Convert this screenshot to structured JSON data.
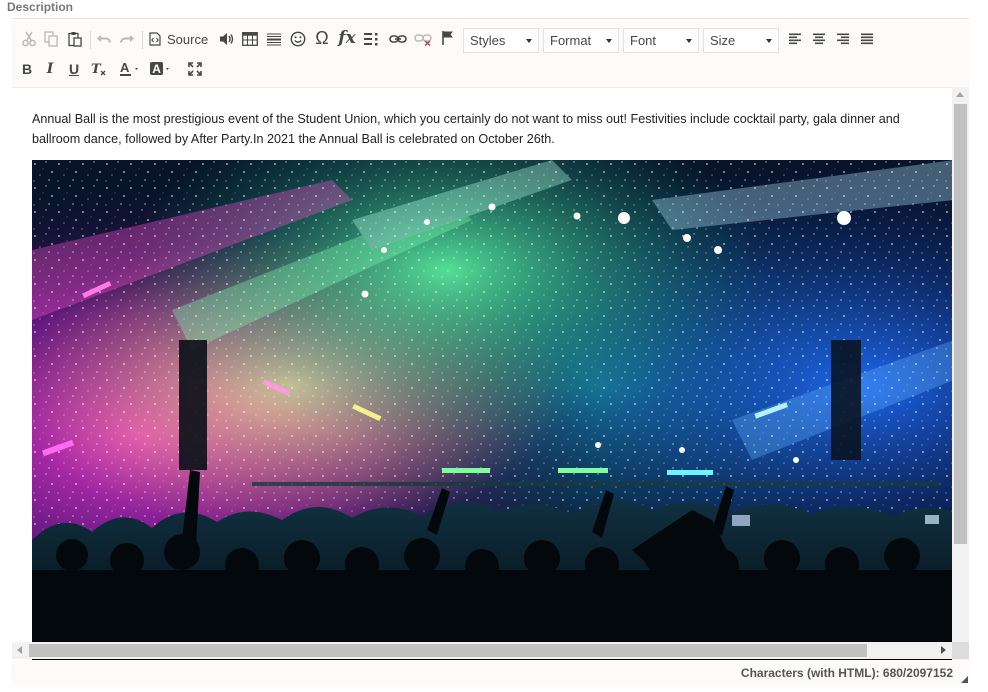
{
  "field": {
    "label": "Description"
  },
  "toolbar": {
    "source_label": "Source",
    "styles_label": "Styles",
    "format_label": "Format",
    "font_label": "Font",
    "size_label": "Size",
    "fx_label": "fx"
  },
  "content": {
    "paragraph": " Annual Ball is the most prestigious event of the Student Union, which you certainly do not want to miss out! Festivities include cocktail party, gala dinner and ballroom dance, followed by After Party.In 2021 the Annual Ball is celebrated on October 26th."
  },
  "status": {
    "char_count": "Characters (with HTML): 680/2097152"
  },
  "icons": [
    "cut-icon",
    "copy-icon",
    "paste-icon",
    "undo-icon",
    "redo-icon",
    "source-icon",
    "audio-icon",
    "table-icon",
    "horizontal-line-icon",
    "smiley-icon",
    "omega-icon",
    "formula-icon",
    "list-icon",
    "link-icon",
    "unlink-icon",
    "flag-icon",
    "align-left-icon",
    "align-center-icon",
    "align-right-icon",
    "justify-icon",
    "bold-icon",
    "italic-icon",
    "underline-icon",
    "clear-format-icon",
    "text-color-icon",
    "background-color-icon",
    "maximize-icon"
  ],
  "colors": {
    "toolbar_bg": "#fdfaf9",
    "icon": "#474747",
    "icon_disabled": "#b9b9b9"
  }
}
